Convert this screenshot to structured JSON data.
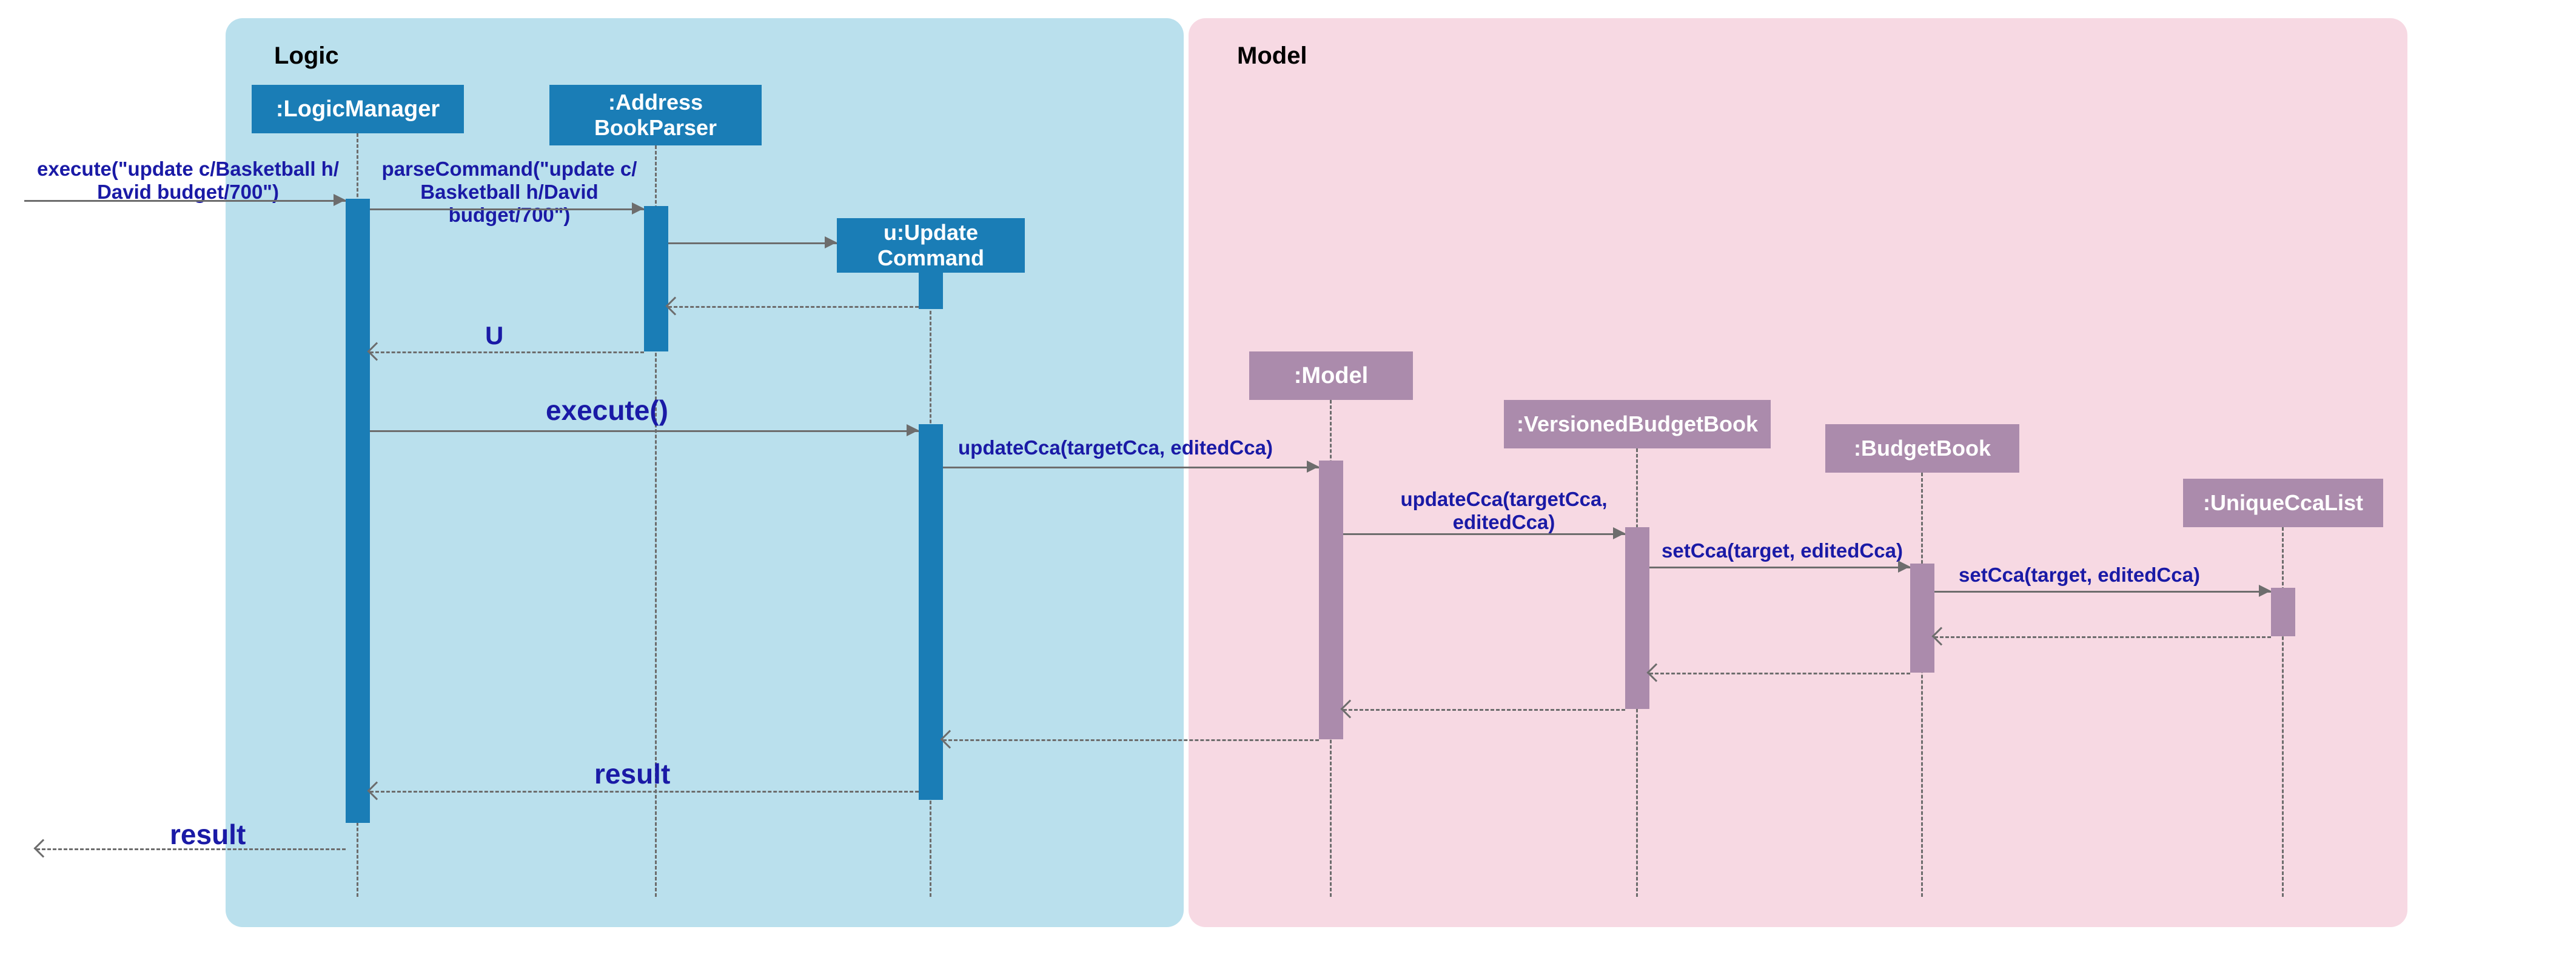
{
  "panels": {
    "logic": "Logic",
    "model": "Model"
  },
  "participants": {
    "logicManager": ":LogicManager",
    "addressBookParser": ":Address\nBookParser",
    "updateCommand": "u:Update\nCommand",
    "model": ":Model",
    "versionedBudgetBook": ":VersionedBudgetBook",
    "budgetBook": ":BudgetBook",
    "uniqueCcaList": ":UniqueCcaList"
  },
  "messages": {
    "execute1": "execute(\"update c/Basketball h/\nDavid budget/700\")",
    "parseCommand": "parseCommand(\"update c/\nBasketball h/David budget/700\")",
    "u": "U",
    "execute2": "execute()",
    "updateCca1": "updateCca(targetCca, editedCca)",
    "updateCca2": "updateCca(targetCca,\neditedCca)",
    "setCca1": "setCca(target, editedCca)",
    "setCca2": "setCca(target, editedCca)",
    "result1": "result",
    "result2": "result"
  },
  "colors": {
    "logicPanel": "#bae0ed",
    "modelPanel": "#f7d9e3",
    "logicBox": "#1a7db6",
    "modelBox": "#ab8bac",
    "labelText": "#1a1aa6"
  }
}
